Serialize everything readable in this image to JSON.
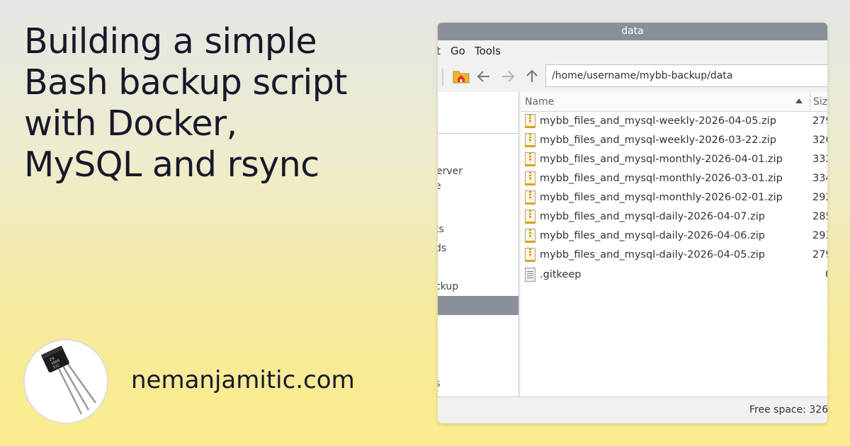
{
  "post": {
    "title_lines": [
      "Building a simple",
      "Bash backup script",
      "with Docker,",
      "MySQL and rsync"
    ],
    "site": "nemanjamitic.com"
  },
  "window": {
    "title": "data",
    "menu": [
      "t",
      "Go",
      "Tools"
    ],
    "path": "/home/username/mybb-backup/data",
    "toolbar_icons": [
      "home-folder-icon",
      "back-arrow-icon",
      "forward-arrow-icon",
      "up-arrow-icon"
    ],
    "sidebar_items": [
      "erver",
      "e",
      "ts",
      "ds",
      "ckup",
      "s"
    ],
    "columns": {
      "name": "Name",
      "size": "Siz"
    },
    "files": [
      {
        "name": "mybb_files_and_mysql-weekly-2026-04-05.zip",
        "size": "279",
        "icon": "zip-file-icon"
      },
      {
        "name": "mybb_files_and_mysql-weekly-2026-03-22.zip",
        "size": "326",
        "icon": "zip-file-icon"
      },
      {
        "name": "mybb_files_and_mysql-monthly-2026-04-01.zip",
        "size": "332",
        "icon": "zip-file-icon"
      },
      {
        "name": "mybb_files_and_mysql-monthly-2026-03-01.zip",
        "size": "334",
        "icon": "zip-file-icon"
      },
      {
        "name": "mybb_files_and_mysql-monthly-2026-02-01.zip",
        "size": "292",
        "icon": "zip-file-icon"
      },
      {
        "name": "mybb_files_and_mysql-daily-2026-04-07.zip",
        "size": "285",
        "icon": "zip-file-icon"
      },
      {
        "name": "mybb_files_and_mysql-daily-2026-04-06.zip",
        "size": "293",
        "icon": "zip-file-icon"
      },
      {
        "name": "mybb_files_and_mysql-daily-2026-04-05.zip",
        "size": "279",
        "icon": "zip-file-icon"
      },
      {
        "name": ".gitkeep",
        "size": "0",
        "icon": "text-file-icon"
      }
    ],
    "status": "Free space: 326."
  }
}
